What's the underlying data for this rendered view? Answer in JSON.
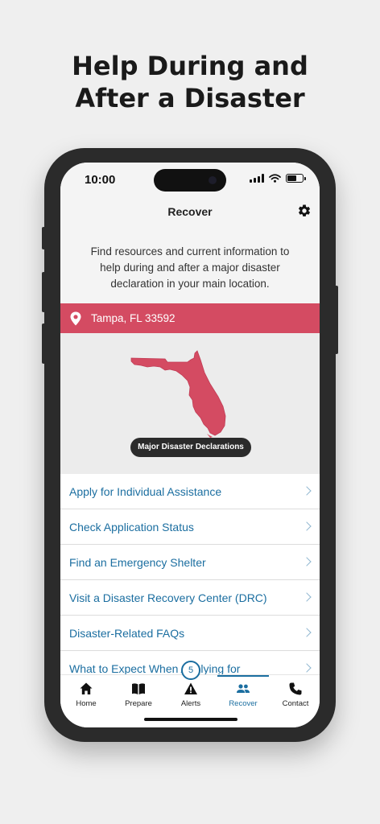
{
  "headline": {
    "line1": "Help During and",
    "line2": "After a Disaster"
  },
  "status_bar": {
    "time": "10:00"
  },
  "header": {
    "title": "Recover"
  },
  "intro": {
    "text": "Find resources and current information to help during and after a major disaster declaration in your main location."
  },
  "location": {
    "text": "Tampa, FL 33592",
    "color": "#d44b62"
  },
  "map": {
    "button_label": "Major Disaster Declarations",
    "state_color": "#d44b62"
  },
  "list": {
    "items": [
      {
        "label": "Apply for Individual Assistance"
      },
      {
        "label": "Check Application Status"
      },
      {
        "label": "Find an Emergency Shelter"
      },
      {
        "label": "Visit a Disaster Recovery Center (DRC)"
      },
      {
        "label": "Disaster-Related FAQs"
      },
      {
        "label": "What to Expect When Applying for"
      }
    ]
  },
  "tabs": {
    "home": "Home",
    "prepare": "Prepare",
    "alerts": "Alerts",
    "recover": "Recover",
    "contact": "Contact",
    "active": "recover",
    "accent_color": "#1b6ea0"
  },
  "alerts_badge": {
    "count": "5"
  }
}
